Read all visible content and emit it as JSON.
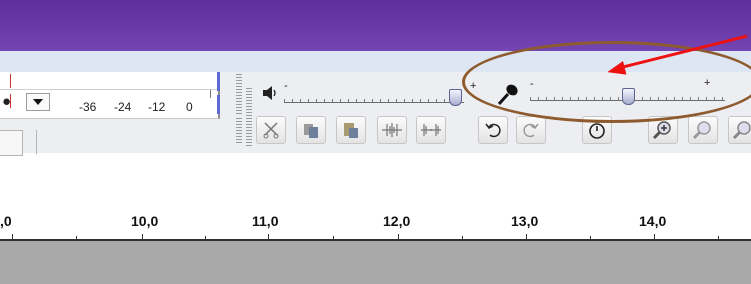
{
  "meter": {
    "scale": [
      "-36",
      "-24",
      "-12",
      "0"
    ]
  },
  "ruler": {
    "labels": [
      ",0",
      "10,0",
      "11,0",
      "12,0",
      "13,0",
      "14,0"
    ]
  },
  "playback_slider": {
    "minus": "-",
    "plus": "+",
    "level": 0.95
  },
  "record_slider": {
    "minus": "-",
    "plus": "+",
    "level": 0.5
  },
  "icons": {
    "speaker": "speaker-icon",
    "mic": "microphone-icon",
    "cut": "cut-icon",
    "copy": "copy-icon",
    "paste": "paste-icon",
    "trim": "trim-icon",
    "silence": "silence-icon",
    "undo": "undo-icon",
    "redo": "redo-icon",
    "timer": "timer-icon",
    "zoom_in": "zoom-in-icon",
    "zoom_out": "zoom-out-icon"
  },
  "annotation": {
    "oval_color": "#8e5b2e",
    "arrow_color": "#ee1111"
  },
  "colors": {
    "title_bar": "#6a3aa8",
    "track_bg": "#a8a8a8",
    "meter_peak": "#5b6bd2"
  }
}
